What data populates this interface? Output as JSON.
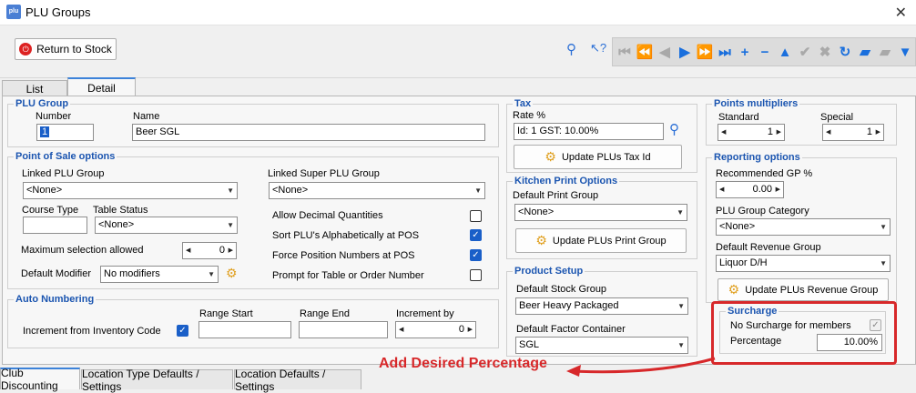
{
  "window": {
    "title": "PLU Groups",
    "icon": "plu-app-icon",
    "close": "✕"
  },
  "toolbar": {
    "return_label": "Return to Stock",
    "icons": [
      "search-icon",
      "pointer-help-icon"
    ],
    "nav": [
      {
        "n": "first-record-icon",
        "g": "⏮",
        "c": "grey"
      },
      {
        "n": "prev-page-icon",
        "g": "⏪",
        "c": "grey"
      },
      {
        "n": "prev-record-icon",
        "g": "◀",
        "c": "grey"
      },
      {
        "n": "next-record-icon",
        "g": "▶",
        "c": "blue"
      },
      {
        "n": "next-page-icon",
        "g": "⏩",
        "c": "blue"
      },
      {
        "n": "last-record-icon",
        "g": "⏭",
        "c": "blue"
      },
      {
        "n": "insert-icon",
        "g": "+",
        "c": "blue"
      },
      {
        "n": "delete-icon",
        "g": "−",
        "c": "blue"
      },
      {
        "n": "edit-icon",
        "g": "▲",
        "c": "blue"
      },
      {
        "n": "post-icon",
        "g": "✔",
        "c": "grey"
      },
      {
        "n": "cancel-icon",
        "g": "✖",
        "c": "grey"
      },
      {
        "n": "refresh-icon",
        "g": "↻",
        "c": "blue"
      },
      {
        "n": "book-icon",
        "g": "▰",
        "c": "blue"
      },
      {
        "n": "book-grey-icon",
        "g": "▰",
        "c": "grey"
      },
      {
        "n": "filter-icon",
        "g": "▼",
        "c": "blue"
      }
    ]
  },
  "tabs": {
    "list": "List",
    "detail": "Detail"
  },
  "plu_group": {
    "title": "PLU Group",
    "number_label": "Number",
    "number_value": "1",
    "name_label": "Name",
    "name_value": "Beer SGL"
  },
  "pos": {
    "title": "Point of Sale options",
    "linked_plu_label": "Linked PLU Group",
    "linked_plu_value": "<None>",
    "linked_super_label": "Linked Super PLU Group",
    "linked_super_value": "<None>",
    "course_label": "Course Type",
    "course_value": "",
    "table_status_label": "Table Status",
    "table_status_value": "<None>",
    "max_sel_label": "Maximum selection allowed",
    "max_sel_value": "0",
    "def_mod_label": "Default Modifier",
    "def_mod_value": "No modifiers",
    "allow_dec": "Allow Decimal Quantities",
    "allow_dec_checked": false,
    "sort_plu": "Sort PLU's Alphabetically at POS",
    "sort_plu_checked": true,
    "force_pos": "Force Position Numbers at POS",
    "force_pos_checked": true,
    "prompt_tbl": "Prompt for Table or Order Number",
    "prompt_tbl_checked": false
  },
  "auto": {
    "title": "Auto Numbering",
    "inc_label": "Increment from Inventory Code",
    "inc_checked": true,
    "range_start": "Range Start",
    "range_end": "Range End",
    "increment_by": "Increment by",
    "increment_value": "0"
  },
  "tax": {
    "title": "Tax",
    "rate_label": "Rate %",
    "rate_value": "Id: 1 GST: 10.00%",
    "update_btn": "Update PLUs Tax Id"
  },
  "kitchen": {
    "title": "Kitchen Print Options",
    "def_print_label": "Default Print Group",
    "def_print_value": "<None>",
    "update_btn": "Update PLUs Print Group"
  },
  "product": {
    "title": "Product Setup",
    "stock_label": "Default Stock Group",
    "stock_value": "Beer Heavy Packaged",
    "factor_label": "Default Factor Container",
    "factor_value": "SGL"
  },
  "points": {
    "title": "Points multipliers",
    "standard_label": "Standard",
    "standard_value": "1",
    "special_label": "Special",
    "special_value": "1"
  },
  "reporting": {
    "title": "Reporting options",
    "gp_label": "Recommended GP %",
    "gp_value": "0.00",
    "category_label": "PLU Group Category",
    "category_value": "<None>",
    "revenue_label": "Default Revenue Group",
    "revenue_value": "Liquor D/H",
    "update_btn": "Update PLUs Revenue Group"
  },
  "surcharge": {
    "title": "Surcharge",
    "no_members": "No Surcharge for members",
    "no_members_checked": true,
    "pct_label": "Percentage",
    "pct_value": "10.00%"
  },
  "annotation": {
    "text": "Add Desired Percentage",
    "color": "#d7282a"
  },
  "bottom_tabs": [
    "Club Discounting",
    "Location Type Defaults / Settings",
    "Location Defaults / Settings"
  ]
}
